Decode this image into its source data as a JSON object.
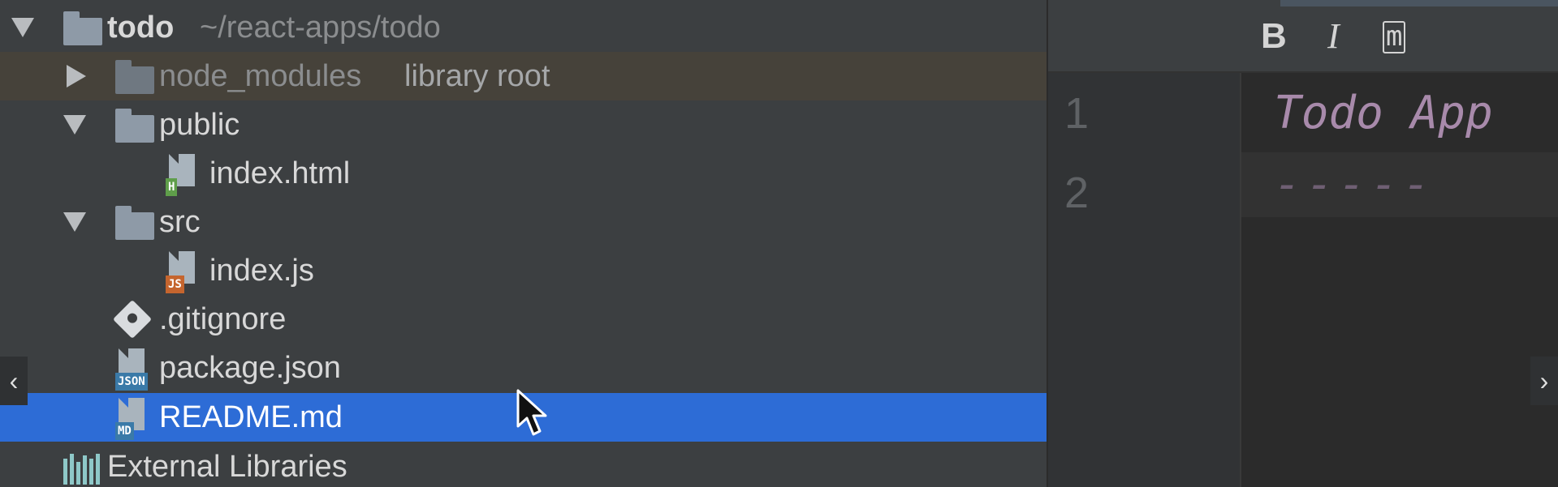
{
  "project_tree": {
    "root": {
      "name": "todo",
      "path": "~/react-apps/todo",
      "folder_icon": "folder-icon",
      "expanded": true
    },
    "items": [
      {
        "name": "node_modules",
        "hint": "library root",
        "icon": "folder-icon",
        "expanded": false,
        "excluded": true
      },
      {
        "name": "public",
        "icon": "folder-icon",
        "expanded": true
      },
      {
        "name": "index.html",
        "icon": "html-file-icon",
        "tag": "H",
        "tag_color": "#5f9e4a"
      },
      {
        "name": "src",
        "icon": "folder-icon",
        "expanded": true
      },
      {
        "name": "index.js",
        "icon": "js-file-icon",
        "tag": "JS",
        "tag_color": "#c5652e"
      },
      {
        "name": ".gitignore",
        "icon": "gitignore-icon"
      },
      {
        "name": "package.json",
        "icon": "json-file-icon",
        "tag": "JSON",
        "tag_color": "#3a7aa8"
      },
      {
        "name": "README.md",
        "icon": "markdown-file-icon",
        "tag": "MD",
        "tag_color": "#3a7aa8",
        "selected": true
      },
      {
        "name": "External Libraries",
        "icon": "external-libraries-icon"
      }
    ]
  },
  "editor": {
    "toolbar": {
      "bold": "B",
      "italic": "I",
      "monospace": "m"
    },
    "line_numbers": [
      "1",
      "2"
    ],
    "lines": [
      "Todo App",
      "-----"
    ]
  },
  "scroll": {
    "left": "‹",
    "right": "›"
  },
  "colors": {
    "selection": "#2d6cd6",
    "excluded_row": "#46423a",
    "panel_bg": "#3c3f41",
    "editor_bg": "#2b2b2b"
  }
}
